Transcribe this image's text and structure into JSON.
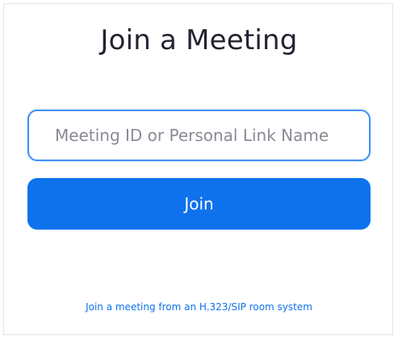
{
  "dialog": {
    "title": "Join a Meeting",
    "meeting_input": {
      "placeholder": "Meeting ID or Personal Link Name",
      "value": ""
    },
    "join_button_label": "Join",
    "room_system_link": "Join a meeting from an H.323/SIP room system"
  },
  "colors": {
    "accent": "#0e72ed",
    "input_border": "#3f8ff2",
    "title_text": "#232333"
  }
}
